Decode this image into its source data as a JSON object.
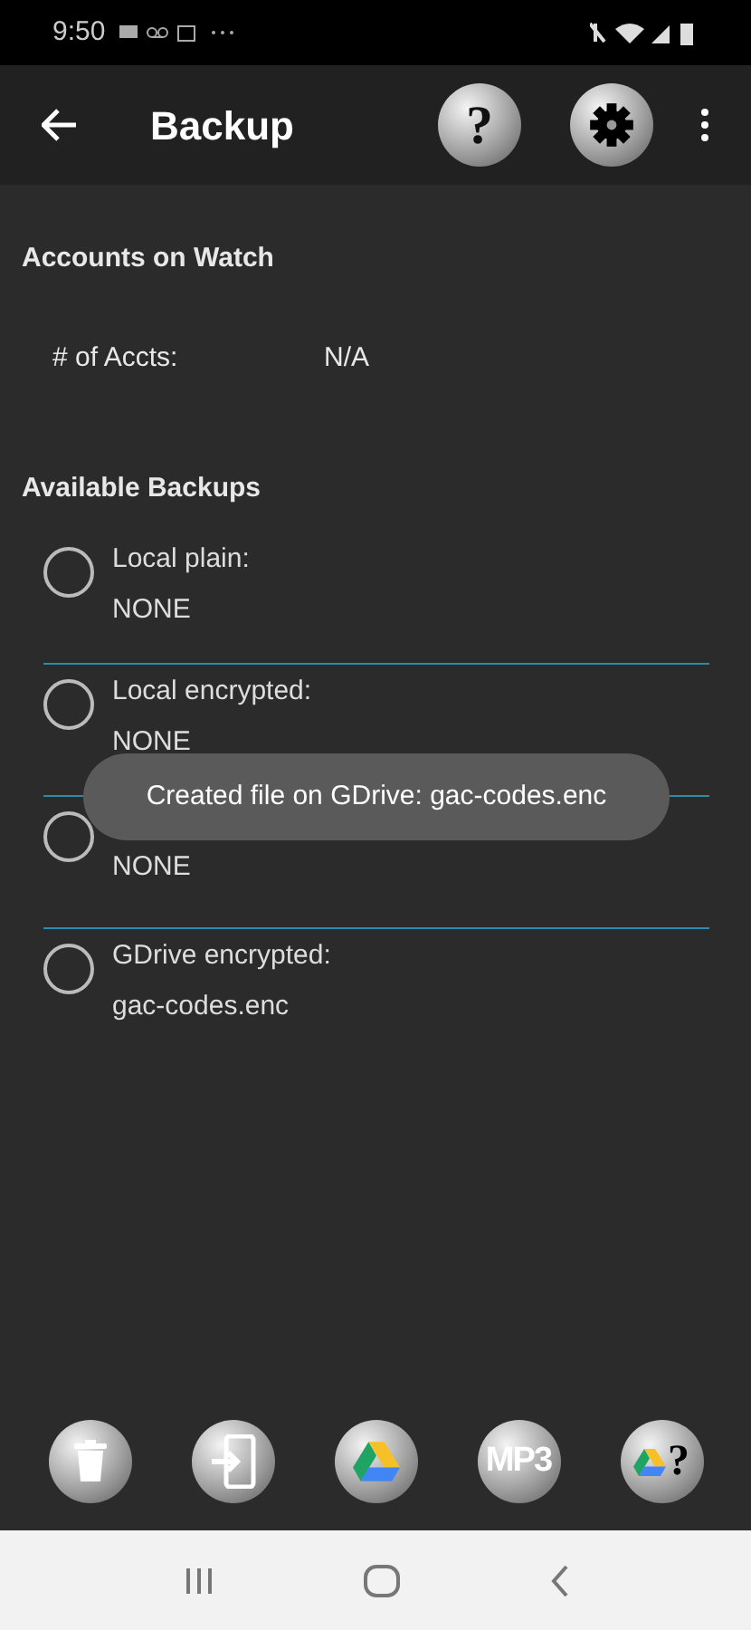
{
  "status_bar": {
    "time": "9:50"
  },
  "app_bar": {
    "title": "Backup",
    "help_label": "?"
  },
  "accounts": {
    "heading": "Accounts on Watch",
    "label": "# of Accts:",
    "value": "N/A"
  },
  "backups": {
    "heading": "Available Backups",
    "items": [
      {
        "label": "Local plain:",
        "value": "NONE",
        "selected": false
      },
      {
        "label": "Local encrypted:",
        "value": "NONE",
        "selected": false
      },
      {
        "value": "NONE",
        "selected": false
      },
      {
        "label": "GDrive encrypted:",
        "value": "gac-codes.enc",
        "selected": false
      }
    ]
  },
  "toast": "Created file on GDrive: gac-codes.enc",
  "toolbar": [
    {
      "kind": "trash"
    },
    {
      "kind": "import"
    },
    {
      "kind": "drive"
    },
    {
      "kind": "text",
      "label": "MP3"
    },
    {
      "kind": "drive-help",
      "label": "?"
    }
  ]
}
